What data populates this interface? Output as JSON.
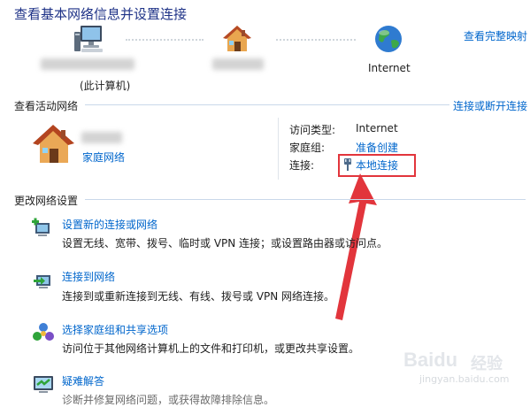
{
  "header": {
    "title": "查看基本网络信息并设置连接",
    "full_map_link": "查看完整映射"
  },
  "network_map": {
    "computer_label": "(此计算机)",
    "internet_label": "Internet"
  },
  "active_networks": {
    "heading": "查看活动网络",
    "connect_disconnect_link": "连接或断开连接",
    "network_type_link": "家庭网络",
    "access_type_label": "访问类型:",
    "access_type_value": "Internet",
    "homegroup_label": "家庭组:",
    "homegroup_value": "准备创建",
    "connection_label": "连接:",
    "connection_value": "本地连接"
  },
  "change_settings": {
    "heading": "更改网络设置",
    "tasks": [
      {
        "title": "设置新的连接或网络",
        "desc": "设置无线、宽带、拨号、临时或 VPN 连接；或设置路由器或访问点。"
      },
      {
        "title": "连接到网络",
        "desc": "连接到或重新连接到无线、有线、拨号或 VPN 网络连接。"
      },
      {
        "title": "选择家庭组和共享选项",
        "desc": "访问位于其他网络计算机上的文件和打印机，或更改共享设置。"
      },
      {
        "title": "疑难解答",
        "desc": "诊断并修复网络问题，或获得故障排除信息。"
      }
    ]
  },
  "watermark": {
    "brand": "Baidu",
    "suffix": "经验",
    "url": "jingyan.baidu.com"
  },
  "colors": {
    "title": "#1e3287",
    "link": "#0066cc",
    "highlight": "#e2353c"
  }
}
